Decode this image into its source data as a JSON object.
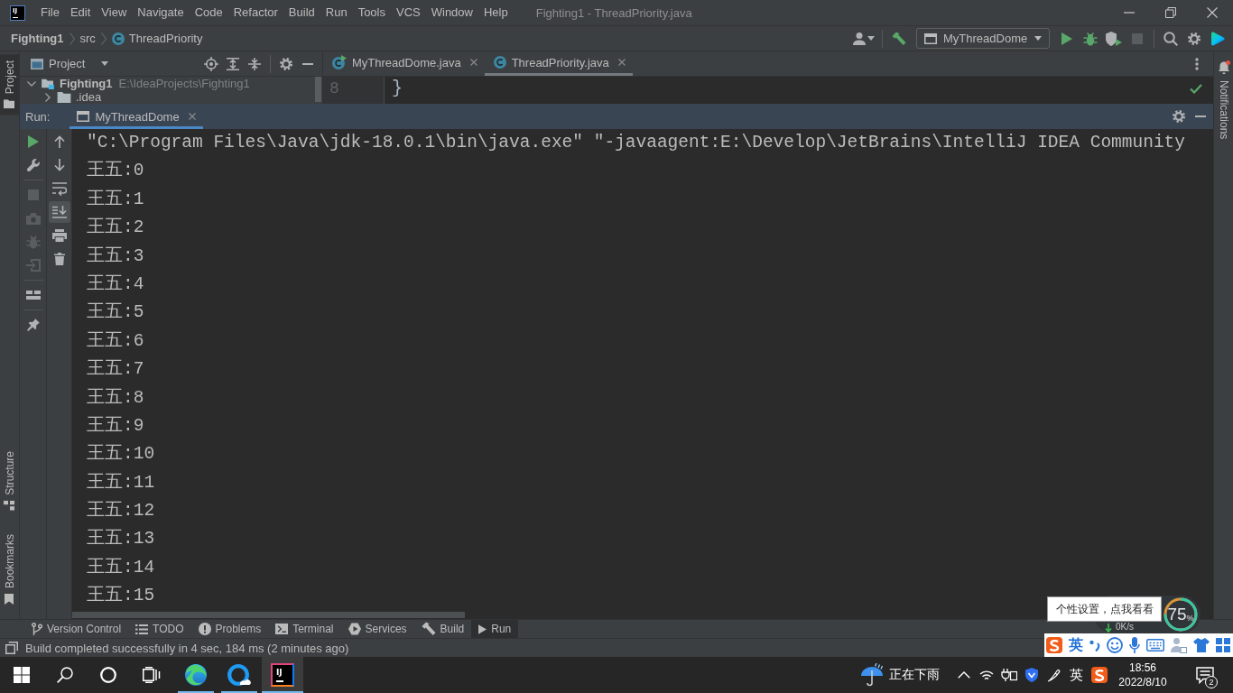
{
  "window": {
    "logo_text": "IJ",
    "menu": [
      "File",
      "Edit",
      "View",
      "Navigate",
      "Code",
      "Refactor",
      "Build",
      "Run",
      "Tools",
      "VCS",
      "Window",
      "Help"
    ],
    "title": "Fighting1 - ThreadPriority.java"
  },
  "navigation": {
    "breadcrumbs": [
      {
        "label": "Fighting1",
        "kind": "project"
      },
      {
        "label": "src",
        "kind": "folder"
      },
      {
        "label": "ThreadPriority",
        "kind": "class"
      }
    ],
    "run_configuration": "MyThreadDome",
    "actions": [
      {
        "kind": "run",
        "disabled": false
      },
      {
        "kind": "debug",
        "disabled": false
      },
      {
        "kind": "coverage",
        "disabled": false
      },
      {
        "kind": "stop",
        "disabled": true
      }
    ]
  },
  "side_tabs": {
    "left_top": [
      {
        "label": "Project",
        "kind": "project",
        "selected": true
      }
    ],
    "left_bottom": [
      {
        "label": "Structure",
        "kind": "structure",
        "selected": false
      },
      {
        "label": "Bookmarks",
        "kind": "bookmarks",
        "selected": false
      }
    ],
    "right": [
      {
        "label": "Notifications",
        "unread": true
      }
    ]
  },
  "project_panel": {
    "title": "Project",
    "tree": [
      {
        "label": "Fighting1",
        "path": "E:\\IdeaProjects\\Fighting1",
        "expanded": true,
        "children": [
          {
            "label": ".idea",
            "expanded": false
          }
        ]
      }
    ]
  },
  "editor": {
    "tabs": [
      {
        "label": "MyThreadDome.java",
        "kind": "runnable",
        "selected": false
      },
      {
        "label": "ThreadPriority.java",
        "kind": "class",
        "selected": true
      }
    ],
    "lines": [
      {
        "number": "8",
        "code": "}"
      }
    ]
  },
  "run_panel": {
    "label": "Run:",
    "tabs": [
      {
        "label": "MyThreadDome",
        "selected": true
      }
    ],
    "left_tools": [
      {
        "kind": "rerun",
        "disabled": false
      },
      {
        "kind": "modify",
        "disabled": false
      },
      {
        "kind": "separator"
      },
      {
        "kind": "stop",
        "disabled": true
      },
      {
        "kind": "snapshot",
        "disabled": true
      },
      {
        "kind": "threads",
        "disabled": true
      },
      {
        "kind": "exit",
        "disabled": true
      },
      {
        "kind": "separator"
      },
      {
        "kind": "layout",
        "disabled": false
      },
      {
        "kind": "separator"
      },
      {
        "kind": "pin",
        "disabled": false
      }
    ],
    "console_tools": [
      {
        "kind": "up",
        "selected": false
      },
      {
        "kind": "down",
        "selected": false
      },
      {
        "kind": "wrap",
        "selected": false
      },
      {
        "kind": "scroll_end",
        "selected": true
      },
      {
        "kind": "print",
        "selected": false
      },
      {
        "kind": "clear",
        "selected": false
      }
    ],
    "console": [
      "\"C:\\Program Files\\Java\\jdk-18.0.1\\bin\\java.exe\" \"-javaagent:E:\\Develop\\JetBrains\\IntelliJ IDEA Community",
      "王五:0",
      "王五:1",
      "王五:2",
      "王五:3",
      "王五:4",
      "王五:5",
      "王五:6",
      "王五:7",
      "王五:8",
      "王五:9",
      "王五:10",
      "王五:11",
      "王五:12",
      "王五:13",
      "王五:14",
      "王五:15"
    ]
  },
  "tool_tabs": [
    {
      "label": "Version Control",
      "kind": "vcs",
      "selected": false
    },
    {
      "label": "TODO",
      "kind": "todo",
      "selected": false
    },
    {
      "label": "Problems",
      "kind": "problems",
      "selected": false
    },
    {
      "label": "Terminal",
      "kind": "terminal",
      "selected": false
    },
    {
      "label": "Services",
      "kind": "services",
      "selected": false
    },
    {
      "label": "Build",
      "kind": "build",
      "selected": false
    },
    {
      "label": "Run",
      "kind": "run",
      "selected": true
    }
  ],
  "status_bar": {
    "message": "Build completed successfully in 4 sec, 184 ms (2 minutes ago)"
  },
  "taskbar": {
    "apps": [
      {
        "kind": "swirl",
        "running": true,
        "selected": false
      },
      {
        "kind": "cloud",
        "running": true,
        "selected": false
      },
      {
        "kind": "tile",
        "logo_text": "IJ",
        "running": true,
        "selected": true
      }
    ],
    "weather": "正在下雨",
    "language": "英",
    "time": "18:56",
    "date": "2022/8/10",
    "notification_count": "2"
  },
  "system_monitor": {
    "speed": "0K/s",
    "reading": "75",
    "unit": "%",
    "level": 0.75
  },
  "ime_toolbar": {
    "tooltip": "个性设置，点我看看",
    "mode": "英"
  }
}
